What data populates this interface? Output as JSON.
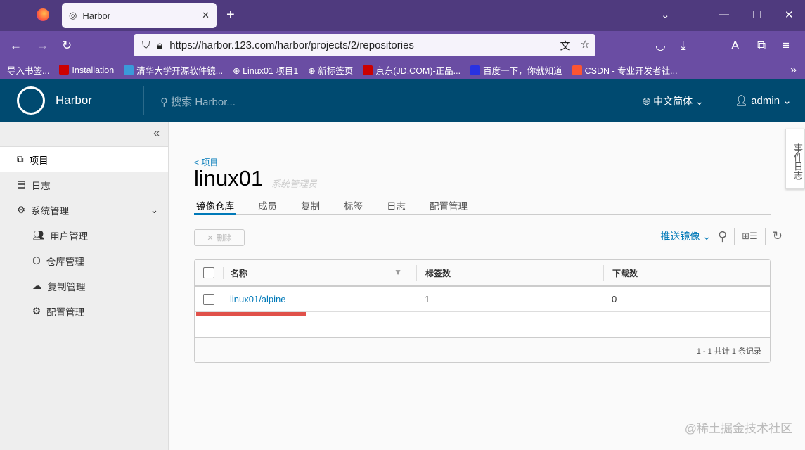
{
  "browser": {
    "tab_title": "Harbor",
    "url": "https://harbor.123.com/harbor/projects/2/repositories",
    "bookmarks": [
      "导入书签...",
      "Installation",
      "清华大学开源软件镜...",
      "Linux01 项目1",
      "新标签页",
      "京东(JD.COM)-正品...",
      "百度一下，你就知道",
      "CSDN - 专业开发者社..."
    ]
  },
  "header": {
    "brand": "Harbor",
    "search_placeholder": "搜索 Harbor...",
    "language": "中文简体",
    "user": "admin"
  },
  "sidebar": {
    "items": [
      {
        "label": "项目"
      },
      {
        "label": "日志"
      },
      {
        "label": "系统管理"
      },
      {
        "label": "用户管理"
      },
      {
        "label": "仓库管理"
      },
      {
        "label": "复制管理"
      },
      {
        "label": "配置管理"
      }
    ]
  },
  "main": {
    "back": "< 项目",
    "title": "linux01",
    "role": "系统管理员",
    "tabs": [
      "镜像仓库",
      "成员",
      "复制",
      "标签",
      "日志",
      "配置管理"
    ],
    "delete": "删除",
    "push": "推送镜像",
    "columns": [
      "名称",
      "标签数",
      "下载数"
    ],
    "rows": [
      {
        "name": "linux01/alpine",
        "tags": "1",
        "downloads": "0"
      }
    ],
    "footer": "1 - 1 共计 1 条记录"
  },
  "event_log": "事件日志",
  "watermark": "@稀土掘金技术社区"
}
